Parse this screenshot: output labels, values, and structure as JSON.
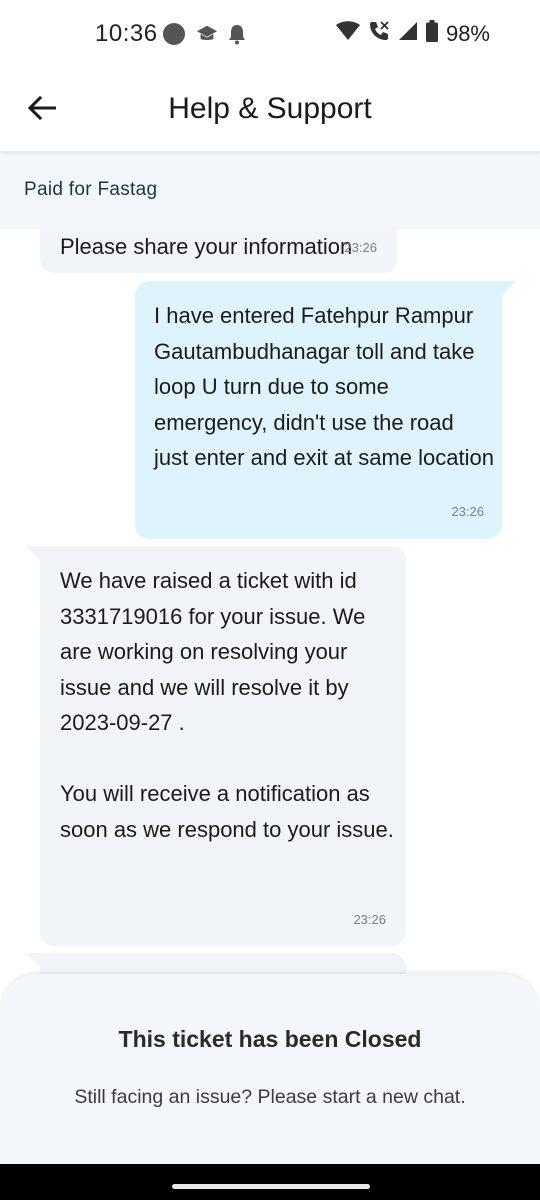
{
  "status_bar": {
    "time": "10:36",
    "battery": "98%",
    "icons": [
      "circle-icon",
      "graduation-cap-icon",
      "bell-icon",
      "wifi-icon",
      "call-icon",
      "signal-icon",
      "battery-icon"
    ]
  },
  "header": {
    "title": "Help & Support",
    "back_icon": "back-arrow-icon"
  },
  "subject": "Paid for Fastag",
  "messages": [
    {
      "direction": "incoming",
      "text": "Please share your information",
      "time": "23:26"
    },
    {
      "direction": "outgoing",
      "text": "I have entered Fatehpur Rampur Gautambudhanagar toll and take loop U turn due to some emergency, didn't use the road just enter and exit at same location",
      "time": "23:26"
    },
    {
      "direction": "incoming",
      "text": "We have raised a ticket with id 3331719016 for your issue. We are working on resolving your issue and we will resolve it by 2023-09-27 .\n\nYou will receive a notification as soon as we respond to your issue.",
      "time": "23:26"
    }
  ],
  "closed_notice": {
    "title": "This ticket has been Closed",
    "subtitle": "Still facing an issue? Please start a new chat."
  },
  "colors": {
    "incoming_bubble": "#f1f4f9",
    "outgoing_bubble": "#dff3fc",
    "subject_bar": "#f3f6fa"
  }
}
